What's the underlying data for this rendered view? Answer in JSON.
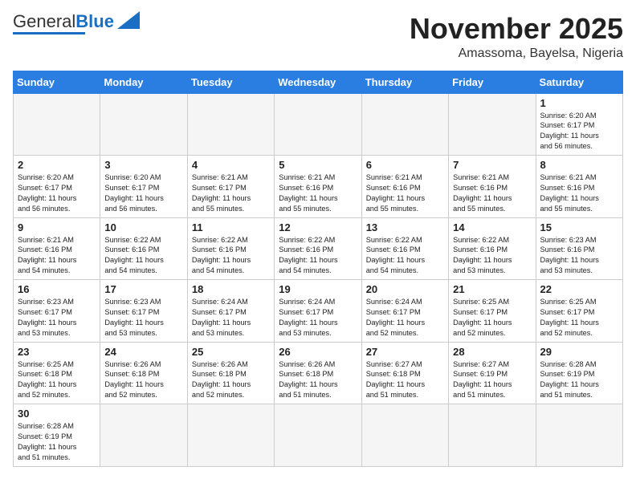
{
  "header": {
    "logo_general": "General",
    "logo_blue": "Blue",
    "month_title": "November 2025",
    "subtitle": "Amassoma, Bayelsa, Nigeria"
  },
  "days_of_week": [
    "Sunday",
    "Monday",
    "Tuesday",
    "Wednesday",
    "Thursday",
    "Friday",
    "Saturday"
  ],
  "weeks": [
    [
      {
        "day": "",
        "info": ""
      },
      {
        "day": "",
        "info": ""
      },
      {
        "day": "",
        "info": ""
      },
      {
        "day": "",
        "info": ""
      },
      {
        "day": "",
        "info": ""
      },
      {
        "day": "",
        "info": ""
      },
      {
        "day": "1",
        "info": "Sunrise: 6:20 AM\nSunset: 6:17 PM\nDaylight: 11 hours\nand 56 minutes."
      }
    ],
    [
      {
        "day": "2",
        "info": "Sunrise: 6:20 AM\nSunset: 6:17 PM\nDaylight: 11 hours\nand 56 minutes."
      },
      {
        "day": "3",
        "info": "Sunrise: 6:20 AM\nSunset: 6:17 PM\nDaylight: 11 hours\nand 56 minutes."
      },
      {
        "day": "4",
        "info": "Sunrise: 6:21 AM\nSunset: 6:17 PM\nDaylight: 11 hours\nand 55 minutes."
      },
      {
        "day": "5",
        "info": "Sunrise: 6:21 AM\nSunset: 6:16 PM\nDaylight: 11 hours\nand 55 minutes."
      },
      {
        "day": "6",
        "info": "Sunrise: 6:21 AM\nSunset: 6:16 PM\nDaylight: 11 hours\nand 55 minutes."
      },
      {
        "day": "7",
        "info": "Sunrise: 6:21 AM\nSunset: 6:16 PM\nDaylight: 11 hours\nand 55 minutes."
      },
      {
        "day": "8",
        "info": "Sunrise: 6:21 AM\nSunset: 6:16 PM\nDaylight: 11 hours\nand 55 minutes."
      }
    ],
    [
      {
        "day": "9",
        "info": "Sunrise: 6:21 AM\nSunset: 6:16 PM\nDaylight: 11 hours\nand 54 minutes."
      },
      {
        "day": "10",
        "info": "Sunrise: 6:22 AM\nSunset: 6:16 PM\nDaylight: 11 hours\nand 54 minutes."
      },
      {
        "day": "11",
        "info": "Sunrise: 6:22 AM\nSunset: 6:16 PM\nDaylight: 11 hours\nand 54 minutes."
      },
      {
        "day": "12",
        "info": "Sunrise: 6:22 AM\nSunset: 6:16 PM\nDaylight: 11 hours\nand 54 minutes."
      },
      {
        "day": "13",
        "info": "Sunrise: 6:22 AM\nSunset: 6:16 PM\nDaylight: 11 hours\nand 54 minutes."
      },
      {
        "day": "14",
        "info": "Sunrise: 6:22 AM\nSunset: 6:16 PM\nDaylight: 11 hours\nand 53 minutes."
      },
      {
        "day": "15",
        "info": "Sunrise: 6:23 AM\nSunset: 6:16 PM\nDaylight: 11 hours\nand 53 minutes."
      }
    ],
    [
      {
        "day": "16",
        "info": "Sunrise: 6:23 AM\nSunset: 6:17 PM\nDaylight: 11 hours\nand 53 minutes."
      },
      {
        "day": "17",
        "info": "Sunrise: 6:23 AM\nSunset: 6:17 PM\nDaylight: 11 hours\nand 53 minutes."
      },
      {
        "day": "18",
        "info": "Sunrise: 6:24 AM\nSunset: 6:17 PM\nDaylight: 11 hours\nand 53 minutes."
      },
      {
        "day": "19",
        "info": "Sunrise: 6:24 AM\nSunset: 6:17 PM\nDaylight: 11 hours\nand 53 minutes."
      },
      {
        "day": "20",
        "info": "Sunrise: 6:24 AM\nSunset: 6:17 PM\nDaylight: 11 hours\nand 52 minutes."
      },
      {
        "day": "21",
        "info": "Sunrise: 6:25 AM\nSunset: 6:17 PM\nDaylight: 11 hours\nand 52 minutes."
      },
      {
        "day": "22",
        "info": "Sunrise: 6:25 AM\nSunset: 6:17 PM\nDaylight: 11 hours\nand 52 minutes."
      }
    ],
    [
      {
        "day": "23",
        "info": "Sunrise: 6:25 AM\nSunset: 6:18 PM\nDaylight: 11 hours\nand 52 minutes."
      },
      {
        "day": "24",
        "info": "Sunrise: 6:26 AM\nSunset: 6:18 PM\nDaylight: 11 hours\nand 52 minutes."
      },
      {
        "day": "25",
        "info": "Sunrise: 6:26 AM\nSunset: 6:18 PM\nDaylight: 11 hours\nand 52 minutes."
      },
      {
        "day": "26",
        "info": "Sunrise: 6:26 AM\nSunset: 6:18 PM\nDaylight: 11 hours\nand 51 minutes."
      },
      {
        "day": "27",
        "info": "Sunrise: 6:27 AM\nSunset: 6:18 PM\nDaylight: 11 hours\nand 51 minutes."
      },
      {
        "day": "28",
        "info": "Sunrise: 6:27 AM\nSunset: 6:19 PM\nDaylight: 11 hours\nand 51 minutes."
      },
      {
        "day": "29",
        "info": "Sunrise: 6:28 AM\nSunset: 6:19 PM\nDaylight: 11 hours\nand 51 minutes."
      }
    ],
    [
      {
        "day": "30",
        "info": "Sunrise: 6:28 AM\nSunset: 6:19 PM\nDaylight: 11 hours\nand 51 minutes."
      },
      {
        "day": "",
        "info": ""
      },
      {
        "day": "",
        "info": ""
      },
      {
        "day": "",
        "info": ""
      },
      {
        "day": "",
        "info": ""
      },
      {
        "day": "",
        "info": ""
      },
      {
        "day": "",
        "info": ""
      }
    ]
  ]
}
